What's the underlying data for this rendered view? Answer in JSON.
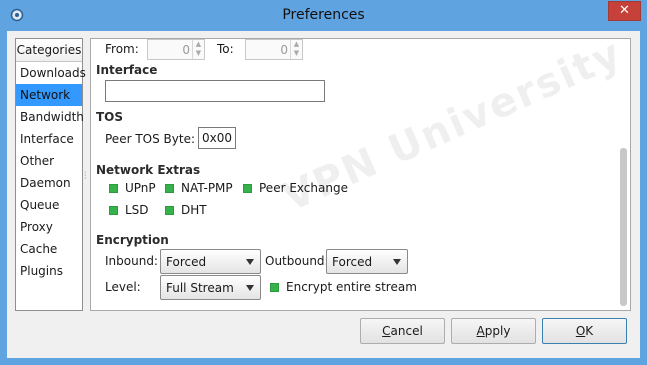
{
  "window": {
    "title": "Preferences",
    "close_glyph": "✕",
    "app_icon": "app-icon"
  },
  "categories": {
    "header": "Categories",
    "items": [
      "Downloads",
      "Network",
      "Bandwidth",
      "Interface",
      "Other",
      "Daemon",
      "Queue",
      "Proxy",
      "Cache",
      "Plugins"
    ],
    "selected": "Network"
  },
  "network": {
    "from_label": "From:",
    "from_value": "0",
    "to_label": "To:",
    "to_value": "0",
    "interface": {
      "heading": "Interface",
      "value": ""
    },
    "tos": {
      "heading": "TOS",
      "label": "Peer TOS Byte:",
      "value": "0x00"
    },
    "extras": {
      "heading": "Network Extras",
      "items": [
        {
          "label": "UPnP",
          "checked": true
        },
        {
          "label": "NAT-PMP",
          "checked": true
        },
        {
          "label": "Peer Exchange",
          "checked": true
        },
        {
          "label": "LSD",
          "checked": true
        },
        {
          "label": "DHT",
          "checked": true
        }
      ]
    },
    "encryption": {
      "heading": "Encryption",
      "inbound_label": "Inbound:",
      "inbound_value": "Forced",
      "outbound_label": "Outbound:",
      "outbound_value": "Forced",
      "level_label": "Level:",
      "level_value": "Full Stream",
      "encrypt_stream_label": "Encrypt entire stream",
      "encrypt_stream_checked": true
    }
  },
  "watermark": "VPN University",
  "buttons": {
    "cancel": {
      "mnemonic": "C",
      "rest": "ancel"
    },
    "apply": {
      "mnemonic": "A",
      "rest": "pply"
    },
    "ok": {
      "mnemonic": "O",
      "rest": "K"
    }
  },
  "colors": {
    "titlebar": "#5fa3e0",
    "selection": "#3399ff",
    "check": "#35b34a",
    "close": "#c7413b"
  }
}
